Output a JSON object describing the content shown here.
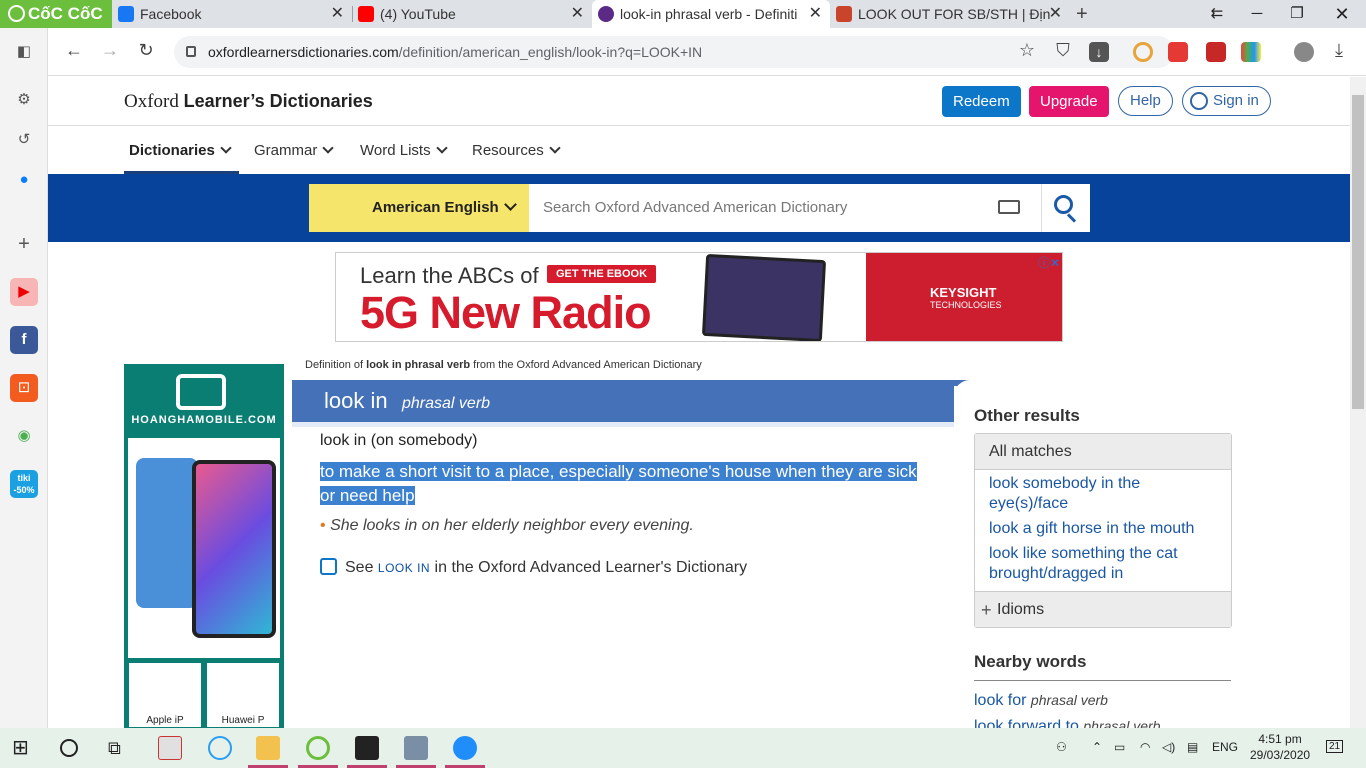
{
  "browser": {
    "brand": "CốC CốC",
    "tabs": [
      {
        "title": "Facebook",
        "color": "#1877f2"
      },
      {
        "title": "(4) YouTube",
        "color": "#ff0000"
      },
      {
        "title": "look-in phrasal verb - Definiti",
        "color": "#5b2a86"
      },
      {
        "title": "LOOK OUT FOR SB/STH | Địn",
        "color": "#c8442a"
      }
    ],
    "url_host": "oxfordlearnersdictionaries.com",
    "url_path": "/definition/american_english/look-in?q=LOOK+IN"
  },
  "site": {
    "logo_plain": "Oxford ",
    "logo_bold": "Learner’s Dictionaries",
    "redeem": "Redeem",
    "upgrade": "Upgrade",
    "help": "Help",
    "signin": "Sign in",
    "nav": [
      "Dictionaries",
      "Grammar",
      "Word Lists",
      "Resources"
    ],
    "dictionary_selector": "American English",
    "search_placeholder": "Search Oxford Advanced American Dictionary"
  },
  "ad_banner": {
    "line1": "Learn the ABCs of",
    "line2": "5G New Radio",
    "cta": "GET THE EBOOK",
    "brand": "KEYSIGHT",
    "brand_sub": "TECHNOLOGIES"
  },
  "side_ad": {
    "brand": "HOANGHAMOBILE.COM",
    "thumb1": "Apple iP",
    "thumb2": "Huawei P"
  },
  "entry": {
    "breadcrumb_pre": "Definition of ",
    "breadcrumb_term": "look in phrasal verb",
    "breadcrumb_post": " from the Oxford Advanced American Dictionary",
    "headword": "look in",
    "pos": "phrasal verb",
    "sense": "look in (on somebody)",
    "definition": "to make a short visit to a place, especially someone's house when they are sick or need help",
    "example": "She looks in on her elderly neighbor every evening.",
    "see_pre": "See ",
    "see_link": "LOOK IN",
    "see_post": " in the Oxford Advanced Learner's Dictionary"
  },
  "other_results": {
    "title": "Other results",
    "all_matches": "All matches",
    "matches": [
      "look somebody in the eye(s)/face",
      "look a gift horse in the mouth",
      "look like something the cat brought/dragged in"
    ],
    "idioms": "Idioms"
  },
  "nearby": {
    "title": "Nearby words",
    "words": [
      {
        "word": "look for",
        "pos": "phrasal verb"
      },
      {
        "word": "look forward to",
        "pos": "phrasal verb"
      }
    ]
  },
  "taskbar": {
    "lang": "ENG",
    "time": "4:51 pm",
    "date": "29/03/2020",
    "notifications": "21"
  }
}
